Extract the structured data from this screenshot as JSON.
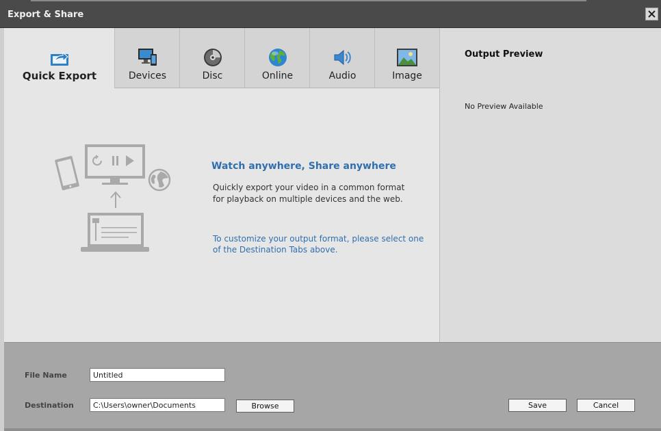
{
  "window": {
    "title": "Export & Share"
  },
  "tabs": [
    {
      "label": "Quick Export",
      "icon": "quick-export-icon",
      "active": true
    },
    {
      "label": "Devices",
      "icon": "devices-icon"
    },
    {
      "label": "Disc",
      "icon": "disc-icon"
    },
    {
      "label": "Online",
      "icon": "globe-icon"
    },
    {
      "label": "Audio",
      "icon": "speaker-icon"
    },
    {
      "label": "Image",
      "icon": "image-icon"
    }
  ],
  "main": {
    "heading": "Watch anywhere, Share anywhere",
    "description": "Quickly export your video in a common format for playback on multiple devices and the web.",
    "hint": "To customize your output format, please select one of the Destination Tabs above."
  },
  "preview": {
    "title": "Output Preview",
    "empty_text": "No Preview Available"
  },
  "form": {
    "file_name_label": "File Name",
    "file_name_value": "Untitled",
    "destination_label": "Destination",
    "destination_value": "C:\\Users\\owner\\Documents",
    "browse_label": "Browse",
    "save_label": "Save",
    "cancel_label": "Cancel"
  },
  "colors": {
    "accent": "#2f6fae",
    "titlebar": "#4a4a4a",
    "bottom_panel": "#a6a6a6"
  }
}
